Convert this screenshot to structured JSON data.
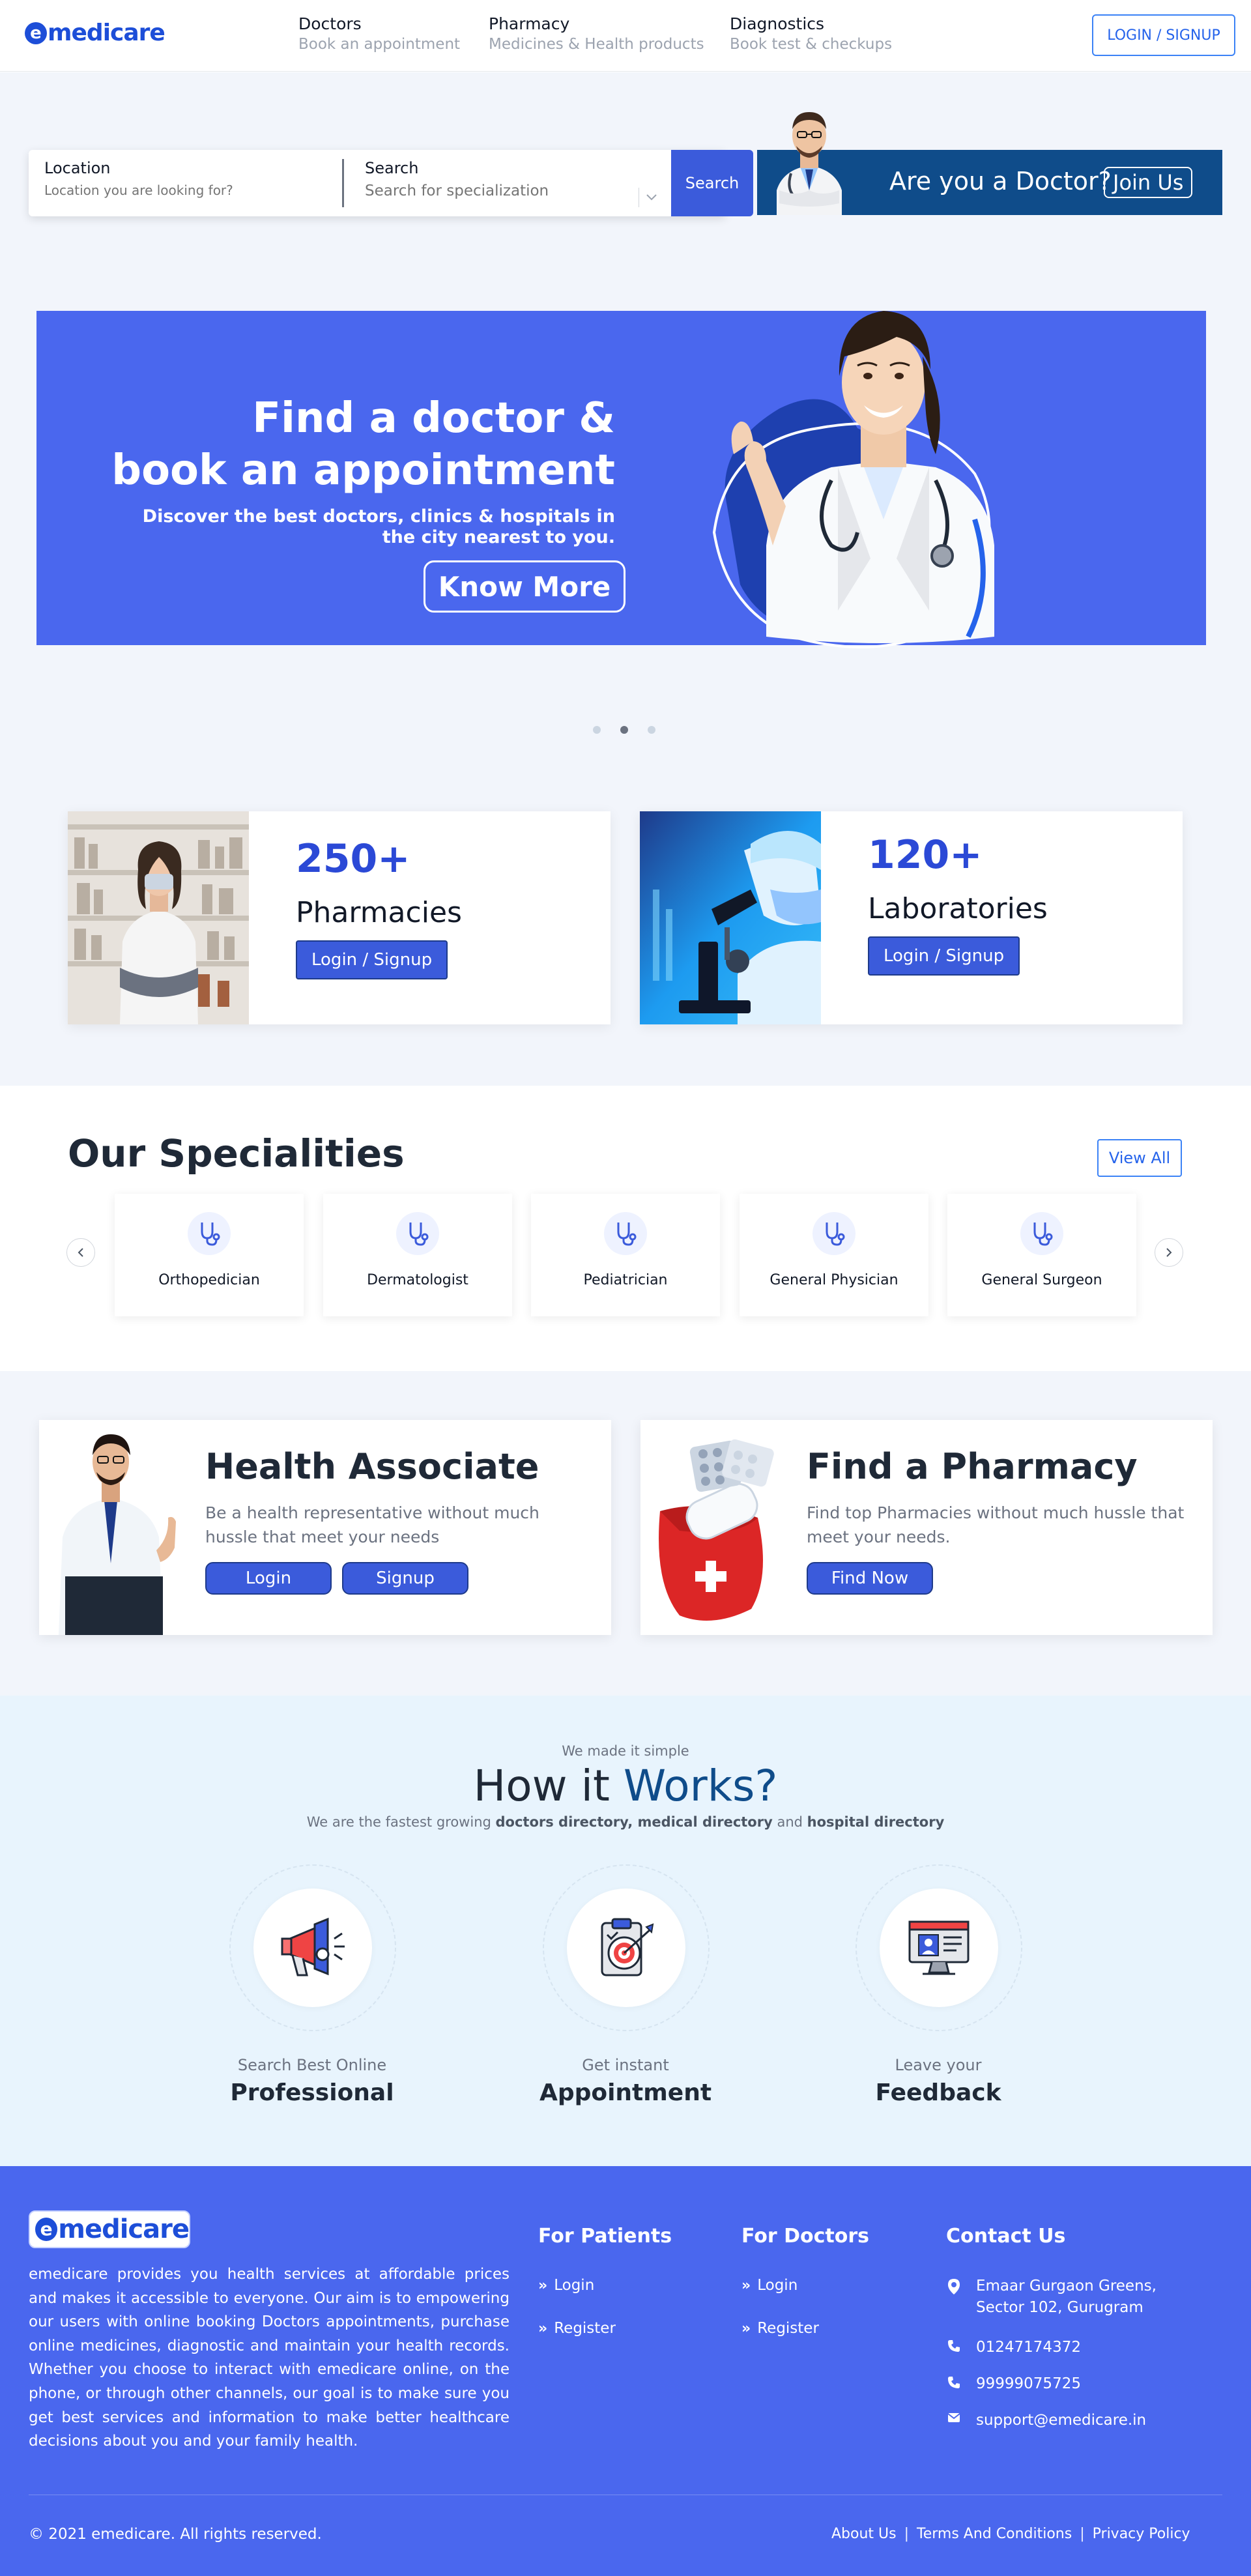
{
  "header": {
    "logo_mark": "e",
    "logo_text": "medicare",
    "nav": [
      {
        "title": "Doctors",
        "subtitle": "Book an appointment"
      },
      {
        "title": "Pharmacy",
        "subtitle": "Medicines & Health products"
      },
      {
        "title": "Diagnostics",
        "subtitle": "Book test & checkups"
      }
    ],
    "login_label": "LOGIN / SIGNUP"
  },
  "search": {
    "location_label": "Location",
    "location_placeholder": "Location you are looking for?",
    "search_label": "Search",
    "search_placeholder": "Search for specialization",
    "button_label": "Search"
  },
  "doctor_banner": {
    "question": "Are you a Doctor?",
    "join_label": "Join Us"
  },
  "hero": {
    "title_line1": "Find a doctor &",
    "title_line2": "book an appointment",
    "subtitle": "Discover the best doctors, clinics & hospitals in the city nearest to you.",
    "button_label": "Know More",
    "slides": 3,
    "active_slide": 2
  },
  "stats": [
    {
      "number": "250+",
      "label": "Pharmacies",
      "button": "Login / Signup"
    },
    {
      "number": "120+",
      "label": "Laboratories",
      "button": "Login / Signup"
    }
  ],
  "specialities": {
    "title": "Our Specialities",
    "view_all": "View All",
    "items": [
      "Orthopedician",
      "Dermatologist",
      "Pediatrician",
      "General Physician",
      "General Surgeon"
    ]
  },
  "health_associate": {
    "title": "Health Associate",
    "description": "Be a health representative without much hussle that meet your needs",
    "login_label": "Login",
    "signup_label": "Signup"
  },
  "find_pharmacy": {
    "title": "Find a Pharmacy",
    "description": "Find top Pharmacies without much hussle that meet your needs.",
    "button_label": "Find Now"
  },
  "how_it_works": {
    "kicker": "We made it simple",
    "title_plain": "How it ",
    "title_accent": "Works?",
    "sub_prefix": "We are the fastest growing ",
    "sub_bold1": "doctors directory, medical directory",
    "sub_mid": " and ",
    "sub_bold2": "hospital directory",
    "steps": [
      {
        "subtitle": "Search Best Online",
        "title": "Professional",
        "icon": "megaphone-icon"
      },
      {
        "subtitle": "Get instant",
        "title": "Appointment",
        "icon": "target-clipboard-icon"
      },
      {
        "subtitle": "Leave your",
        "title": "Feedback",
        "icon": "monitor-profile-icon"
      }
    ]
  },
  "footer": {
    "about": "emedicare provides you health services at affordable prices and makes it accessible to everyone. Our aim is to empowering our users with online booking Doctors appointments, purchase online medicines, diagnostic and maintain your health records. Whether you choose to interact with emedicare online, on the phone, or through other channels, our goal is to make sure you get best services and information to make better healthcare decisions about you and your family health.",
    "patients_title": "For Patients",
    "doctors_title": "For Doctors",
    "contact_title": "Contact Us",
    "login": "Login",
    "register": "Register",
    "address": "Emaar Gurgaon Greens, Sector 102, Gurugram",
    "phone1": "01247174372",
    "phone2": "99999075725",
    "email": "support@emedicare.in",
    "copyright": "© 2021 emedicare. All rights reserved.",
    "about_us": "About Us",
    "terms": "Terms And Conditions",
    "privacy": "Privacy Policy",
    "separator": "|"
  },
  "colors": {
    "primary": "#4a67ee",
    "button": "#3b5bdb",
    "navy": "#0f4c8a",
    "band": "#f2f5fb",
    "how_bg": "#e8f4fd"
  }
}
